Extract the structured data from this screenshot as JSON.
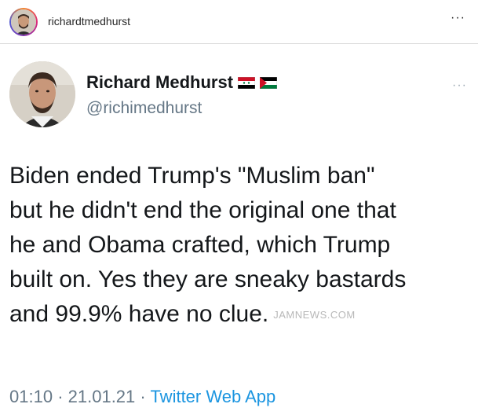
{
  "instagram_header": {
    "username": "richardtmedhurst",
    "more_icon": "···"
  },
  "tweet": {
    "display_name": "Richard Medhurst",
    "handle": "@richimedhurst",
    "flags": [
      "syria-flag",
      "palestine-flag"
    ],
    "more_icon": "···",
    "text_lines": [
      "Biden ended Trump's \"Muslim ban\"",
      "but he didn't end the original one that",
      "he and Obama crafted, which Trump",
      "built on. Yes they are sneaky bastards",
      "and 99.9% have no clue."
    ],
    "watermark": "JAMNEWS.COM",
    "time": "01:10",
    "date": "21.01.21",
    "separator": "·",
    "source": "Twitter Web App"
  },
  "colors": {
    "text": "#14171a",
    "secondary": "#657786",
    "link": "#1b95e0",
    "border": "#dbdbdb"
  }
}
